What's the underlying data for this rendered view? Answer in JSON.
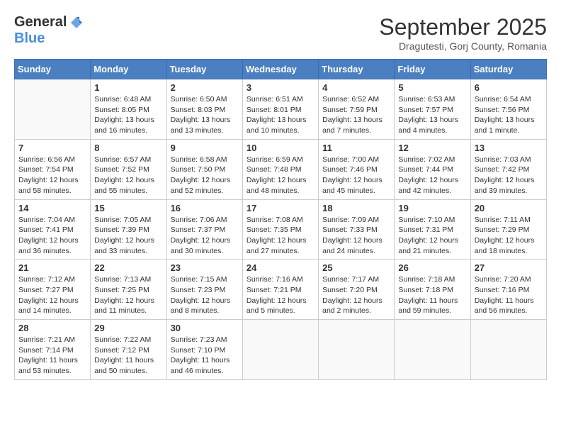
{
  "logo": {
    "general": "General",
    "blue": "Blue"
  },
  "title": {
    "month": "September 2025",
    "location": "Dragutesti, Gorj County, Romania"
  },
  "weekdays": [
    "Sunday",
    "Monday",
    "Tuesday",
    "Wednesday",
    "Thursday",
    "Friday",
    "Saturday"
  ],
  "weeks": [
    [
      {
        "day": "",
        "sunrise": "",
        "sunset": "",
        "daylight": ""
      },
      {
        "day": "1",
        "sunrise": "Sunrise: 6:48 AM",
        "sunset": "Sunset: 8:05 PM",
        "daylight": "Daylight: 13 hours and 16 minutes."
      },
      {
        "day": "2",
        "sunrise": "Sunrise: 6:50 AM",
        "sunset": "Sunset: 8:03 PM",
        "daylight": "Daylight: 13 hours and 13 minutes."
      },
      {
        "day": "3",
        "sunrise": "Sunrise: 6:51 AM",
        "sunset": "Sunset: 8:01 PM",
        "daylight": "Daylight: 13 hours and 10 minutes."
      },
      {
        "day": "4",
        "sunrise": "Sunrise: 6:52 AM",
        "sunset": "Sunset: 7:59 PM",
        "daylight": "Daylight: 13 hours and 7 minutes."
      },
      {
        "day": "5",
        "sunrise": "Sunrise: 6:53 AM",
        "sunset": "Sunset: 7:57 PM",
        "daylight": "Daylight: 13 hours and 4 minutes."
      },
      {
        "day": "6",
        "sunrise": "Sunrise: 6:54 AM",
        "sunset": "Sunset: 7:56 PM",
        "daylight": "Daylight: 13 hours and 1 minute."
      }
    ],
    [
      {
        "day": "7",
        "sunrise": "Sunrise: 6:56 AM",
        "sunset": "Sunset: 7:54 PM",
        "daylight": "Daylight: 12 hours and 58 minutes."
      },
      {
        "day": "8",
        "sunrise": "Sunrise: 6:57 AM",
        "sunset": "Sunset: 7:52 PM",
        "daylight": "Daylight: 12 hours and 55 minutes."
      },
      {
        "day": "9",
        "sunrise": "Sunrise: 6:58 AM",
        "sunset": "Sunset: 7:50 PM",
        "daylight": "Daylight: 12 hours and 52 minutes."
      },
      {
        "day": "10",
        "sunrise": "Sunrise: 6:59 AM",
        "sunset": "Sunset: 7:48 PM",
        "daylight": "Daylight: 12 hours and 48 minutes."
      },
      {
        "day": "11",
        "sunrise": "Sunrise: 7:00 AM",
        "sunset": "Sunset: 7:46 PM",
        "daylight": "Daylight: 12 hours and 45 minutes."
      },
      {
        "day": "12",
        "sunrise": "Sunrise: 7:02 AM",
        "sunset": "Sunset: 7:44 PM",
        "daylight": "Daylight: 12 hours and 42 minutes."
      },
      {
        "day": "13",
        "sunrise": "Sunrise: 7:03 AM",
        "sunset": "Sunset: 7:42 PM",
        "daylight": "Daylight: 12 hours and 39 minutes."
      }
    ],
    [
      {
        "day": "14",
        "sunrise": "Sunrise: 7:04 AM",
        "sunset": "Sunset: 7:41 PM",
        "daylight": "Daylight: 12 hours and 36 minutes."
      },
      {
        "day": "15",
        "sunrise": "Sunrise: 7:05 AM",
        "sunset": "Sunset: 7:39 PM",
        "daylight": "Daylight: 12 hours and 33 minutes."
      },
      {
        "day": "16",
        "sunrise": "Sunrise: 7:06 AM",
        "sunset": "Sunset: 7:37 PM",
        "daylight": "Daylight: 12 hours and 30 minutes."
      },
      {
        "day": "17",
        "sunrise": "Sunrise: 7:08 AM",
        "sunset": "Sunset: 7:35 PM",
        "daylight": "Daylight: 12 hours and 27 minutes."
      },
      {
        "day": "18",
        "sunrise": "Sunrise: 7:09 AM",
        "sunset": "Sunset: 7:33 PM",
        "daylight": "Daylight: 12 hours and 24 minutes."
      },
      {
        "day": "19",
        "sunrise": "Sunrise: 7:10 AM",
        "sunset": "Sunset: 7:31 PM",
        "daylight": "Daylight: 12 hours and 21 minutes."
      },
      {
        "day": "20",
        "sunrise": "Sunrise: 7:11 AM",
        "sunset": "Sunset: 7:29 PM",
        "daylight": "Daylight: 12 hours and 18 minutes."
      }
    ],
    [
      {
        "day": "21",
        "sunrise": "Sunrise: 7:12 AM",
        "sunset": "Sunset: 7:27 PM",
        "daylight": "Daylight: 12 hours and 14 minutes."
      },
      {
        "day": "22",
        "sunrise": "Sunrise: 7:13 AM",
        "sunset": "Sunset: 7:25 PM",
        "daylight": "Daylight: 12 hours and 11 minutes."
      },
      {
        "day": "23",
        "sunrise": "Sunrise: 7:15 AM",
        "sunset": "Sunset: 7:23 PM",
        "daylight": "Daylight: 12 hours and 8 minutes."
      },
      {
        "day": "24",
        "sunrise": "Sunrise: 7:16 AM",
        "sunset": "Sunset: 7:21 PM",
        "daylight": "Daylight: 12 hours and 5 minutes."
      },
      {
        "day": "25",
        "sunrise": "Sunrise: 7:17 AM",
        "sunset": "Sunset: 7:20 PM",
        "daylight": "Daylight: 12 hours and 2 minutes."
      },
      {
        "day": "26",
        "sunrise": "Sunrise: 7:18 AM",
        "sunset": "Sunset: 7:18 PM",
        "daylight": "Daylight: 11 hours and 59 minutes."
      },
      {
        "day": "27",
        "sunrise": "Sunrise: 7:20 AM",
        "sunset": "Sunset: 7:16 PM",
        "daylight": "Daylight: 11 hours and 56 minutes."
      }
    ],
    [
      {
        "day": "28",
        "sunrise": "Sunrise: 7:21 AM",
        "sunset": "Sunset: 7:14 PM",
        "daylight": "Daylight: 11 hours and 53 minutes."
      },
      {
        "day": "29",
        "sunrise": "Sunrise: 7:22 AM",
        "sunset": "Sunset: 7:12 PM",
        "daylight": "Daylight: 11 hours and 50 minutes."
      },
      {
        "day": "30",
        "sunrise": "Sunrise: 7:23 AM",
        "sunset": "Sunset: 7:10 PM",
        "daylight": "Daylight: 11 hours and 46 minutes."
      },
      {
        "day": "",
        "sunrise": "",
        "sunset": "",
        "daylight": ""
      },
      {
        "day": "",
        "sunrise": "",
        "sunset": "",
        "daylight": ""
      },
      {
        "day": "",
        "sunrise": "",
        "sunset": "",
        "daylight": ""
      },
      {
        "day": "",
        "sunrise": "",
        "sunset": "",
        "daylight": ""
      }
    ]
  ]
}
